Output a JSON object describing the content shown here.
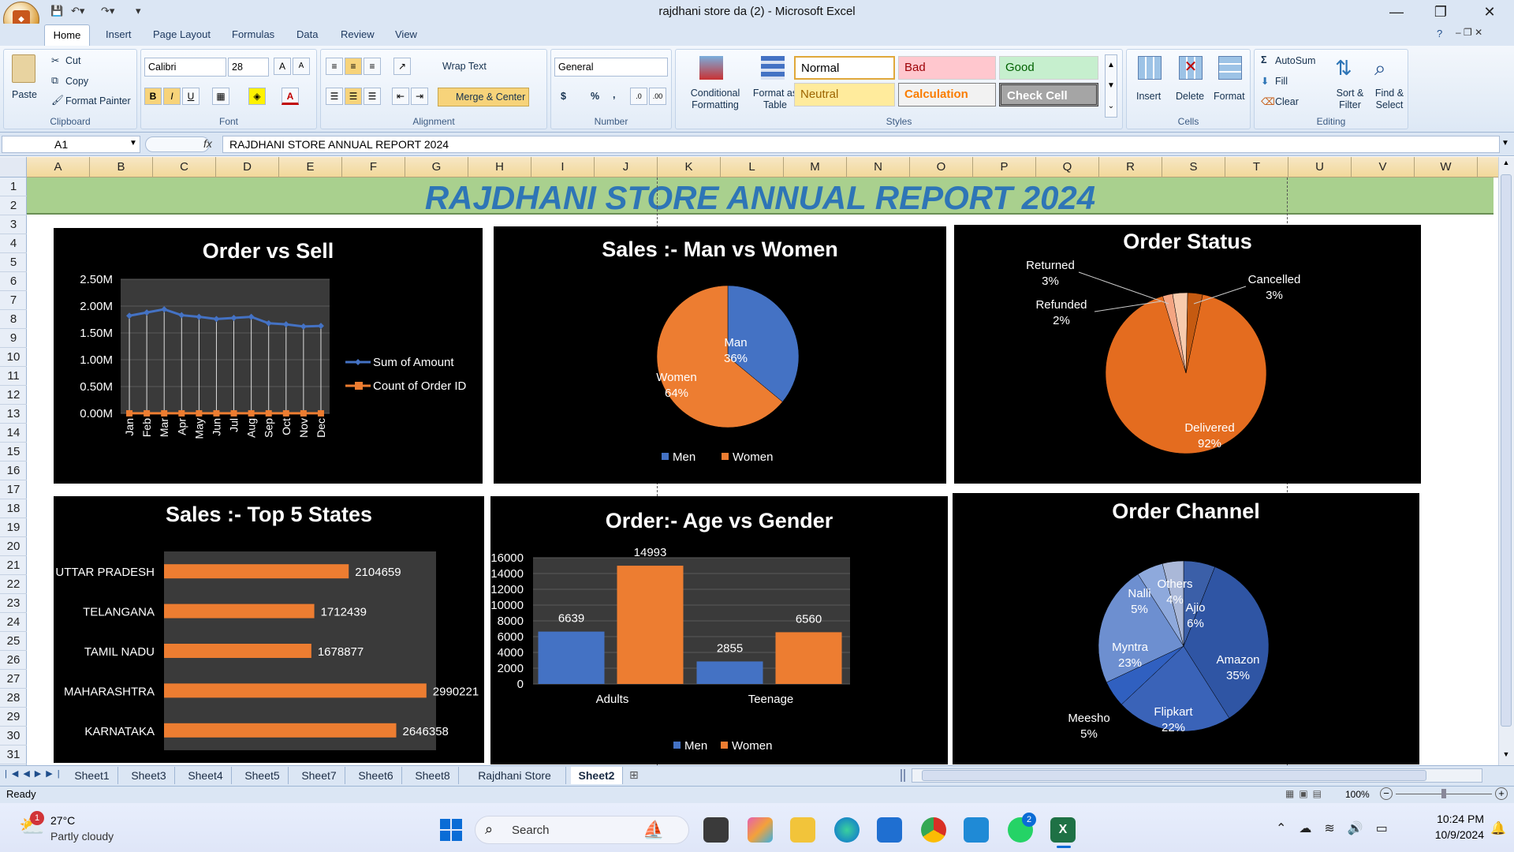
{
  "window": {
    "title": "rajdhani store da (2) - Microsoft Excel"
  },
  "ribbon_tabs": [
    "Home",
    "Insert",
    "Page Layout",
    "Formulas",
    "Data",
    "Review",
    "View"
  ],
  "clipboard": {
    "paste": "Paste",
    "cut": "Cut",
    "copy": "Copy",
    "format_painter": "Format Painter",
    "label": "Clipboard"
  },
  "font": {
    "name": "Calibri",
    "size": "28",
    "label": "Font",
    "bold": "B",
    "italic": "I",
    "underline": "U"
  },
  "alignment": {
    "wrap": "Wrap Text",
    "merge": "Merge & Center",
    "label": "Alignment"
  },
  "number": {
    "format": "General",
    "currency": "$",
    "percent": "%",
    "comma": ",",
    "label": "Number"
  },
  "styles": {
    "conditional": "Conditional Formatting",
    "format_table": "Format as Table",
    "label": "Styles",
    "cells": [
      {
        "text": "Normal",
        "bg": "#ffffff",
        "fg": "#000000"
      },
      {
        "text": "Bad",
        "bg": "#ffc7ce",
        "fg": "#9c0006"
      },
      {
        "text": "Good",
        "bg": "#c6efce",
        "fg": "#006100"
      },
      {
        "text": "Neutral",
        "bg": "#ffeb9c",
        "fg": "#9c6500"
      },
      {
        "text": "Calculation",
        "bg": "#f2f2f2",
        "fg": "#fa7d00"
      },
      {
        "text": "Check Cell",
        "bg": "#a5a5a5",
        "fg": "#ffffff"
      }
    ]
  },
  "cells_group": {
    "insert": "Insert",
    "delete": "Delete",
    "format": "Format",
    "label": "Cells"
  },
  "editing": {
    "autosum": "AutoSum",
    "fill": "Fill",
    "clear": "Clear",
    "sort": "Sort & Filter",
    "find": "Find & Select",
    "label": "Editing"
  },
  "formula_bar": {
    "name_box": "A1",
    "fx": "fx",
    "content": "RAJDHANI STORE ANNUAL REPORT 2024"
  },
  "columns": [
    "A",
    "B",
    "C",
    "D",
    "E",
    "F",
    "G",
    "H",
    "I",
    "J",
    "K",
    "L",
    "M",
    "N",
    "O",
    "P",
    "Q",
    "R",
    "S",
    "T",
    "U",
    "V",
    "W"
  ],
  "rows": [
    "1",
    "2",
    "3",
    "4",
    "5",
    "6",
    "7",
    "8",
    "9",
    "10",
    "11",
    "12",
    "13",
    "14",
    "15",
    "16",
    "17",
    "18",
    "19",
    "20",
    "21",
    "22",
    "23",
    "24",
    "25",
    "26",
    "27",
    "28",
    "29",
    "30",
    "31"
  ],
  "banner": {
    "title": "RAJDHANI STORE ANNUAL REPORT 2024"
  },
  "chart_data": [
    {
      "type": "line",
      "title": "Order vs Sell",
      "categories": [
        "Jan",
        "Feb",
        "Mar",
        "Apr",
        "May",
        "Jun",
        "Jul",
        "Aug",
        "Sep",
        "Oct",
        "Nov",
        "Dec"
      ],
      "series": [
        {
          "name": "Sum of Amount",
          "color": "#4472c4",
          "values": [
            1.82,
            1.88,
            1.94,
            1.83,
            1.8,
            1.76,
            1.78,
            1.8,
            1.68,
            1.66,
            1.62,
            1.63
          ]
        },
        {
          "name": "Count of Order ID",
          "color": "#ed7d31",
          "values": [
            0.001,
            0.001,
            0.001,
            0.001,
            0.001,
            0.001,
            0.001,
            0.001,
            0.001,
            0.001,
            0.001,
            0.001
          ]
        }
      ],
      "yticks": [
        "2.50M",
        "2.00M",
        "1.50M",
        "1.00M",
        "0.50M",
        "0.00M"
      ],
      "ylim": [
        0,
        2.5
      ],
      "legend": "right"
    },
    {
      "type": "pie",
      "title": "Sales :- Man vs Women",
      "slices": [
        {
          "name": "Man",
          "legend": "Men",
          "value": 36,
          "label": "36%",
          "color": "#4472c4"
        },
        {
          "name": "Women",
          "legend": "Women",
          "value": 64,
          "label": "64%",
          "color": "#ed7d31"
        }
      ],
      "legend": "bottom"
    },
    {
      "type": "pie",
      "title": "Order Status",
      "slices": [
        {
          "name": "Delivered",
          "value": 92,
          "label": "92%",
          "color": "#e46c1f"
        },
        {
          "name": "Refunded",
          "value": 2,
          "label": "2%",
          "color": "#f4a582"
        },
        {
          "name": "Returned",
          "value": 3,
          "label": "3%",
          "color": "#f8cbad"
        },
        {
          "name": "Cancelled",
          "value": 3,
          "label": "3%",
          "color": "#c55a11"
        }
      ]
    },
    {
      "type": "bar",
      "orientation": "horizontal",
      "title": "Sales :- Top 5 States",
      "categories": [
        "UTTAR PRADESH",
        "TELANGANA",
        "TAMIL NADU",
        "MAHARASHTRA",
        "KARNATAKA"
      ],
      "values": [
        2104659,
        1712439,
        1678877,
        2990221,
        2646358
      ],
      "xlim": [
        0,
        3100000
      ],
      "color": "#ed7d31"
    },
    {
      "type": "bar",
      "title": "Order:- Age vs Gender",
      "categories": [
        "Adults",
        "Teenage"
      ],
      "series": [
        {
          "name": "Men",
          "color": "#4472c4",
          "values": [
            6639,
            2855
          ]
        },
        {
          "name": "Women",
          "color": "#ed7d31",
          "values": [
            14993,
            6560
          ]
        }
      ],
      "yticks": [
        "16000",
        "14000",
        "12000",
        "10000",
        "8000",
        "6000",
        "4000",
        "2000",
        "0"
      ],
      "ylim": [
        0,
        16000
      ],
      "legend": "bottom"
    },
    {
      "type": "pie",
      "title": "Order Channel",
      "slices": [
        {
          "name": "Amazon",
          "value": 35,
          "label": "35%",
          "color": "#2f55a4"
        },
        {
          "name": "Flipkart",
          "value": 22,
          "label": "22%",
          "color": "#3a63b8"
        },
        {
          "name": "Meesho",
          "value": 5,
          "label": "5%",
          "color": "#3060c0"
        },
        {
          "name": "Myntra",
          "value": 23,
          "label": "23%",
          "color": "#6d8fd0"
        },
        {
          "name": "Nalli",
          "value": 5,
          "label": "5%",
          "color": "#8ea9dc"
        },
        {
          "name": "Others",
          "value": 4,
          "label": "4%",
          "color": "#aab8d8"
        },
        {
          "name": "Ajio",
          "value": 6,
          "label": "6%",
          "color": "#3b5fa8"
        }
      ]
    }
  ],
  "sheet_tabs": [
    "Sheet1",
    "Sheet3",
    "Sheet4",
    "Sheet5",
    "Sheet7",
    "Sheet6",
    "Sheet8",
    "Rajdhani Store",
    "Sheet2"
  ],
  "active_sheet": "Sheet2",
  "status": {
    "ready": "Ready",
    "zoom": "100%"
  },
  "taskbar": {
    "temp": "27°C",
    "weather": "Partly cloudy",
    "search": "Search",
    "time": "10:24 PM",
    "date": "10/9/2024",
    "weather_badge": "1",
    "whatsapp_badge": "2"
  }
}
